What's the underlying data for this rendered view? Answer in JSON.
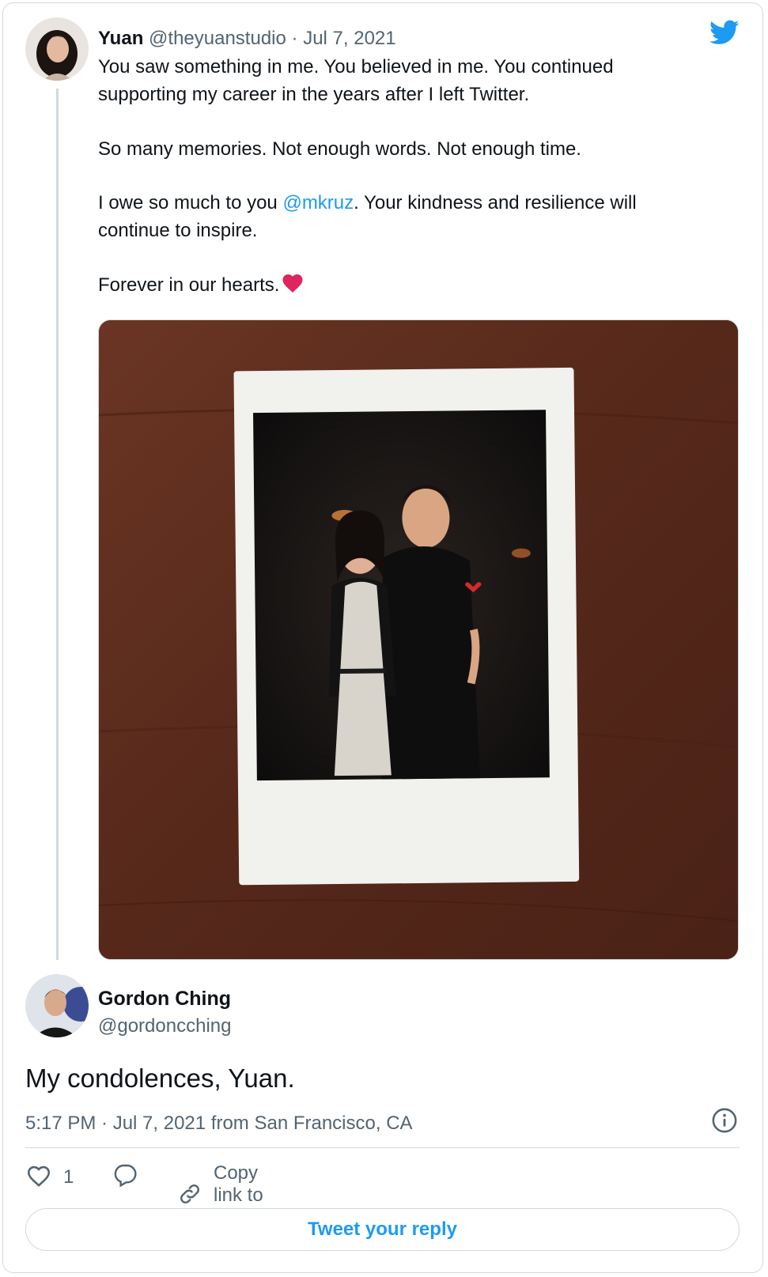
{
  "quoted_tweet": {
    "name": "Yuan",
    "handle": "@theyuanstudio",
    "separator": "·",
    "date": "Jul 7, 2021",
    "line1": "You saw something in me. You believed in me. You continued",
    "line2": "supporting my career in the years after I left Twitter.",
    "line3": "So many memories. Not enough words. Not enough time.",
    "line4_pre": "I owe so much to you ",
    "line4_mention": "@mkruz",
    "line4_post": ". Your kindness and resilience will",
    "line5": "continue to inspire.",
    "line6": "Forever in our hearts.",
    "media_icon": "polaroid-photo"
  },
  "reply": {
    "name": "Gordon Ching",
    "handle": "@gordoncching",
    "text": "My condolences, Yuan.",
    "meta": "5:17 PM · Jul 7, 2021 from San Francisco, CA"
  },
  "actions": {
    "like_count": "1",
    "copy_link_label": "Copy link to Tweet"
  },
  "reply_button_label": "Tweet your reply",
  "icons": {
    "brand": "twitter-bird-icon",
    "like": "heart-outline-icon",
    "reply": "speech-bubble-icon",
    "link": "link-icon",
    "info": "info-icon",
    "emoji": "red-heart-emoji"
  },
  "colors": {
    "brand_blue": "#1d9bf0",
    "text": "#0f1419",
    "muted": "#536471",
    "border": "#cfd9de",
    "heart_red": "#e0245e"
  }
}
